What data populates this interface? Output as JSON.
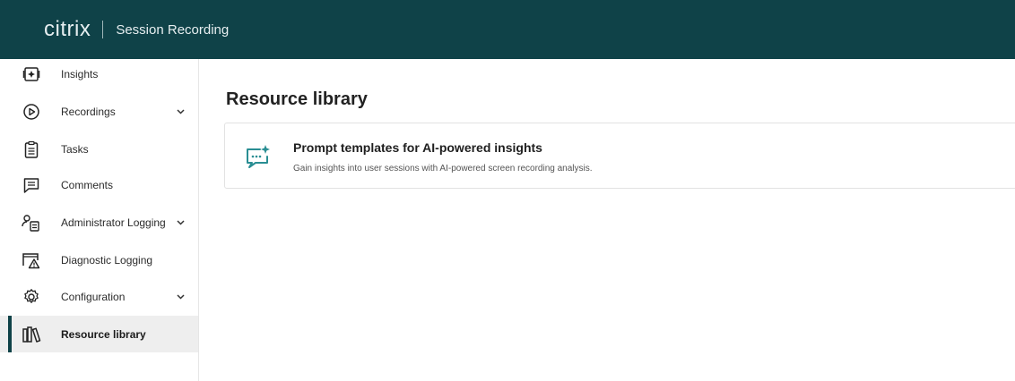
{
  "header": {
    "logo_text": "citrix",
    "product_name": "Session Recording",
    "background_color": "#0f4248"
  },
  "sidebar": {
    "items": [
      {
        "label": "Insights",
        "icon": "insights-icon",
        "has_chevron": false
      },
      {
        "label": "Recordings",
        "icon": "play-circle-icon",
        "has_chevron": true
      },
      {
        "label": "Tasks",
        "icon": "clipboard-icon",
        "has_chevron": false
      },
      {
        "label": "Comments",
        "icon": "comment-icon",
        "has_chevron": false
      },
      {
        "label": "Administrator Logging",
        "icon": "admin-log-icon",
        "has_chevron": true
      },
      {
        "label": "Diagnostic Logging",
        "icon": "diagnostic-warning-icon",
        "has_chevron": false
      },
      {
        "label": "Configuration",
        "icon": "gear-icon",
        "has_chevron": true
      },
      {
        "label": "Resource library",
        "icon": "library-icon",
        "has_chevron": false,
        "active": true
      }
    ]
  },
  "main": {
    "title": "Resource library",
    "cards": [
      {
        "icon": "ai-chat-sparkle-icon",
        "title": "Prompt templates for AI-powered insights",
        "description": "Gain insights into user sessions with AI-powered screen recording analysis."
      }
    ]
  },
  "colors": {
    "accent": "#0f4248",
    "icon_teal": "#2a8e93",
    "active_bg": "#eeeeee"
  }
}
